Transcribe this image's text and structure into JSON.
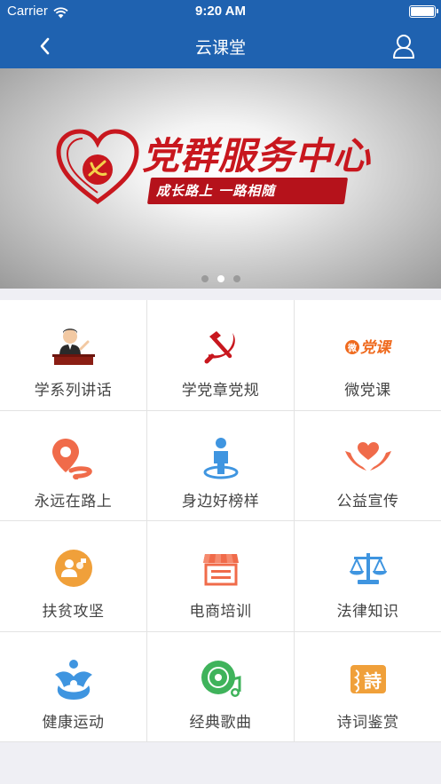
{
  "status_bar": {
    "carrier": "Carrier",
    "time": "9:20 AM"
  },
  "navbar": {
    "title": "云课堂"
  },
  "banner": {
    "title": "党群服务中心",
    "subtitle": "成长路上  一路相随",
    "page_count": 3,
    "active_page": 2
  },
  "grid": {
    "items": [
      {
        "label": "学系列讲话",
        "icon": "speaker-podium-icon"
      },
      {
        "label": "学党章党规",
        "icon": "hammer-sickle-icon"
      },
      {
        "label": "微党课",
        "icon": "weidangke-logo-icon"
      },
      {
        "label": "永远在路上",
        "icon": "map-pin-road-icon"
      },
      {
        "label": "身边好榜样",
        "icon": "person-standing-icon"
      },
      {
        "label": "公益宣传",
        "icon": "heart-hands-icon"
      },
      {
        "label": "扶贫攻坚",
        "icon": "people-chat-icon"
      },
      {
        "label": "电商培训",
        "icon": "storefront-icon"
      },
      {
        "label": "法律知识",
        "icon": "scales-icon"
      },
      {
        "label": "健康运动",
        "icon": "running-figures-icon"
      },
      {
        "label": "经典歌曲",
        "icon": "music-disc-icon"
      },
      {
        "label": "诗词鉴赏",
        "icon": "poem-scroll-icon"
      }
    ]
  },
  "colors": {
    "nav_blue": "#1f62b0",
    "party_red": "#c8171e",
    "orange": "#f07b2a",
    "blue_icon": "#3f95e0",
    "green_icon": "#3fb35b"
  }
}
